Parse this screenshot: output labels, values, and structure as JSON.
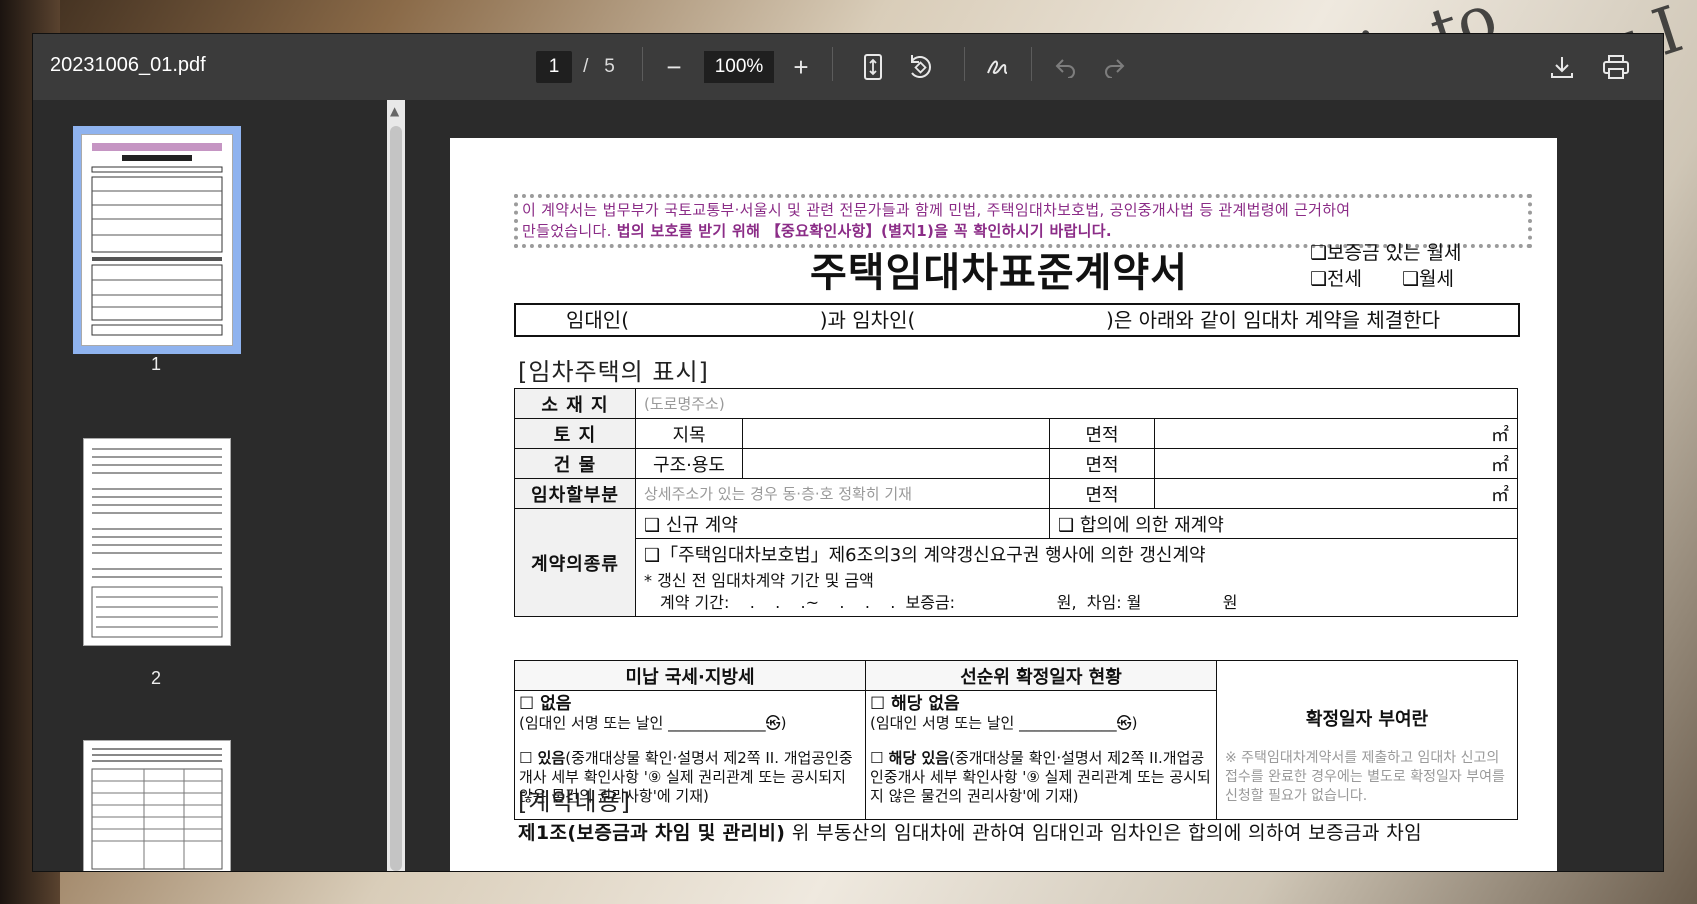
{
  "toolbar": {
    "file_name": "20231006_01.pdf",
    "current_page": "1",
    "page_separator": "/",
    "total_pages": "5",
    "zoom_minus": "−",
    "zoom_level": "100%",
    "zoom_plus": "+",
    "icons": [
      "fit-page-icon",
      "rotate-icon",
      "draw-icon",
      "undo-icon",
      "redo-icon",
      "download-icon",
      "print-icon"
    ]
  },
  "sidebar": {
    "thumbnails": [
      {
        "label": "1"
      },
      {
        "label": "2"
      }
    ]
  },
  "document": {
    "notice_line1": "이 계약서는 법무부가 국토교통부·서울시 및 관련 전문가들과 함께 민법, 주택임대차보호법, 공인중개사법 등 관계법령에 근거하여",
    "notice_line2_plain": "만들었습니다. ",
    "notice_line2_bold": "법의 보호를 받기 위해 【중요확인사항】(별지1)을 꼭 확인하시기 바랍니다.",
    "title": "주택임대차표준계약서",
    "type_option1": "❑보증금 있는 월세",
    "type_option2": "❑전세",
    "type_option3": "❑월세",
    "party_line": "임대인(                              )과 임차인(                              )은 아래와 같이 임대차 계약을 체결한다",
    "section1": "[임차주택의 표시]",
    "rows": {
      "location_label": "소 재 지",
      "location_placeholder": "(도로명주소)",
      "land_label": "토    지",
      "land_sub": "지목",
      "area_label": "면적",
      "area_unit": "㎡",
      "building_label": "건    물",
      "building_sub": "구조·용도",
      "part_label": "임차할부분",
      "part_placeholder": "상세주소가 있는 경우 동·층·호 정확히 기재",
      "contract_type_label": "계약의종류",
      "new_contract": "❑ 신규 계약",
      "renegotiated": "❑ 합의에 의한 재계약",
      "renewal": "❑「주택임대차보호법」제6조의3의 계약갱신요구권 행사에 의한 갱신계약",
      "renewal_note": "* 갱신 전 임대차계약 기간 및 금액",
      "renewal_period": "계약 기간:    .    .    .~    .    .    .  보증금:                    원,  차임: 월                원"
    },
    "tax": {
      "header": "미납 국세·지방세",
      "none": "☐ 없음",
      "none_sign": "(임대인 서명 또는 날인 _____________㉿)",
      "exists_bold": "☐ 있음",
      "exists_text": "(중개대상물 확인·설명서 제2쪽 II. 개업공인중개사 세부 확인사항 '⑨ 실제 권리관계 또는 공시되지 않은 물건의 권리사항'에 기재)"
    },
    "priority": {
      "header": "선순위 확정일자 현황",
      "none": "☐ 해당 없음",
      "none_sign": "(임대인 서명 또는 날인 _____________㉿)",
      "exists_bold": "☐ 해당 있음",
      "exists_text": "(중개대상물 확인·설명서 제2쪽 II.개업공인중개사 세부 확인사항 '⑨ 실제 권리관계 또는 공시되지 않은 물건의 권리사항'에 기재)"
    },
    "fixed_date": {
      "header": "확정일자 부여란",
      "note": "※ 주택임대차계약서를 제출하고 임대차 신고의 접수를 완료한 경우에는 별도로 확정일자 부여를 신청할 필요가 없습니다."
    },
    "section2": "[계약내용]",
    "clause1_bold": "제1조(보증금과 차임 및 관리비)",
    "clause1_text": " 위 부동산의 임대차에 관하여 임대인과 임차인은 합의에 의하여 보증금과 차임"
  }
}
